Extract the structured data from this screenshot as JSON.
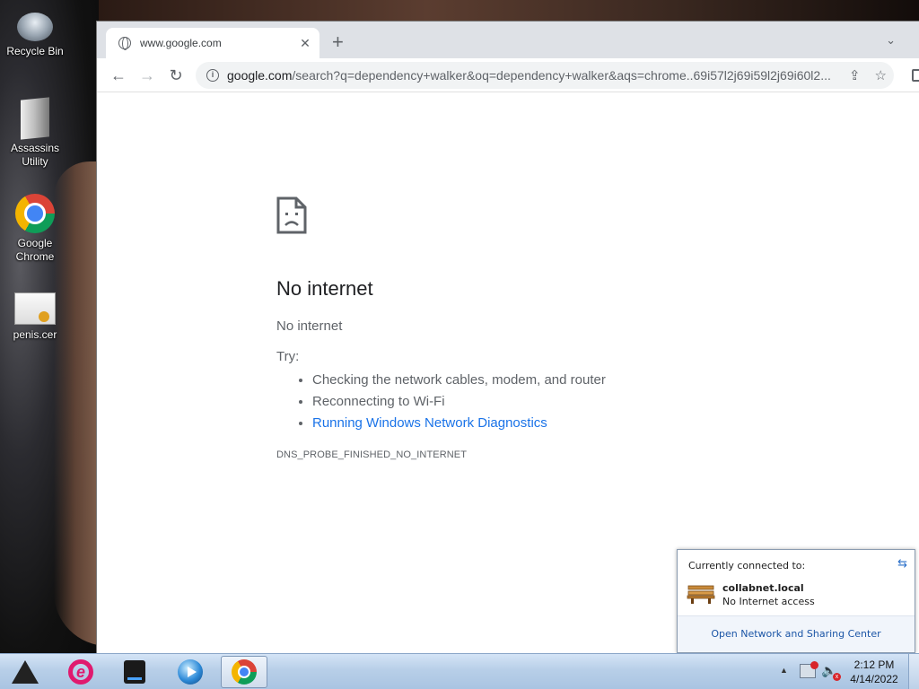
{
  "desktop": {
    "icons": [
      {
        "label": "Recycle Bin"
      },
      {
        "label": "Assassins Utility"
      },
      {
        "label": "Google Chrome"
      },
      {
        "label": "penis.cer"
      }
    ]
  },
  "browser": {
    "tab": {
      "title": "www.google.com",
      "close": "✕"
    },
    "new_tab": "+",
    "tab_menu": "⌄",
    "nav": {
      "back": "←",
      "forward": "→",
      "reload": "↻"
    },
    "omnibox": {
      "domain": "google.com",
      "path": "/search?q=dependency+walker&oq=dependency+walker&aqs=chrome..69i57l2j69i59l2j69i60l2...",
      "info_icon": "i",
      "share_icon": "⇪",
      "star_icon": "☆"
    }
  },
  "error_page": {
    "title": "No internet",
    "subtitle": "No internet",
    "try_label": "Try:",
    "suggestions": [
      "Checking the network cables, modem, and router",
      "Reconnecting to Wi-Fi"
    ],
    "diagnostics_link": "Running Windows Network Diagnostics",
    "error_code": "DNS_PROBE_FINISHED_NO_INTERNET"
  },
  "network_popup": {
    "header": "Currently connected to:",
    "refresh_icon": "⇆",
    "network_name": "collabnet.local",
    "network_status": "No Internet access",
    "footer_link": "Open Network and Sharing Center"
  },
  "taskbar": {
    "ie_glyph": "e",
    "volume_glyph": "🔈",
    "volume_x": "x",
    "tray_arrow": "▲",
    "time": "2:12 PM",
    "date": "4/14/2022"
  },
  "colors": {
    "link": "#1a73e8",
    "error_text": "#5f6368",
    "taskbar": "#b8cfe8"
  }
}
